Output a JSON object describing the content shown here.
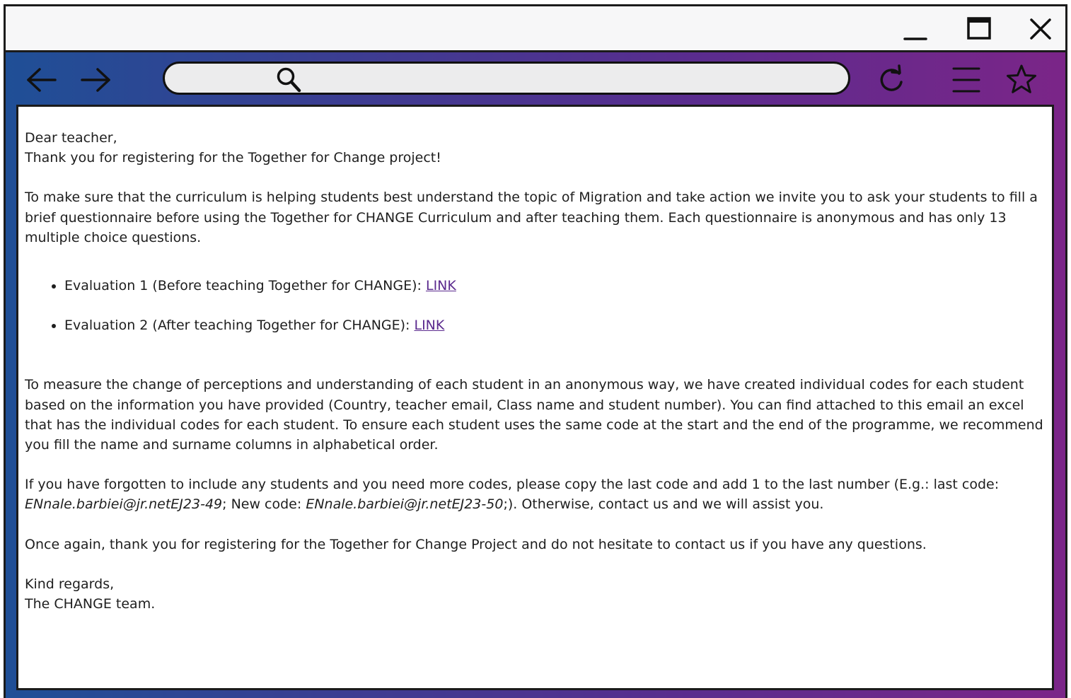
{
  "toolbar": {
    "back_icon": "arrow-left-icon",
    "forward_icon": "arrow-right-icon",
    "search_icon": "search-icon",
    "address_value": "",
    "reload_icon": "reload-icon",
    "menu_icon": "hamburger-menu-icon",
    "favorite_icon": "star-icon"
  },
  "window_controls": [
    "minimize-icon",
    "maximize-icon",
    "close-icon"
  ],
  "colors": {
    "gradient_start": "#1f4f96",
    "gradient_end": "#7b2588",
    "link": "#5b2a8e"
  },
  "email": {
    "greeting": "Dear teacher,",
    "thanks": "Thank you for registering for the Together for Change project!",
    "intro": "To make sure that the curriculum is helping students best understand the topic of Migration and take action we invite you to ask your students to fill a brief questionnaire before using the Together for CHANGE Curriculum and after teaching them. Each questionnaire is anonymous and has only 13 multiple choice questions.",
    "evaluations": [
      {
        "text": "Evaluation 1 (Before teaching Together for CHANGE): ",
        "link": "LINK"
      },
      {
        "text": "Evaluation 2 (After teaching Together for CHANGE): ",
        "link": "LINK"
      }
    ],
    "measure": "To measure the change of perceptions and understanding of each student in an anonymous way, we have created individual codes for each student based on the information you have provided (Country, teacher email, Class name and student number). You can find attached to this email an excel that has the individual codes for each student. To ensure each student uses the same code at the start and the end of the programme, we recommend you fill the name and surname columns in alphabetical order.",
    "forgotten_before": "If you have forgotten to include any students and you need more codes, please copy the last code and add 1 to the last number (E.g.: last code: ",
    "last_code": "ENnale.barbiei@jr.netEJ23-49",
    "new_code_label": "; New code: ",
    "new_code": "ENnale.barbiei@jr.netEJ23-50",
    "forgotten_after": ";). Otherwise, contact us and we will assist you.",
    "closing": "Once again, thank you for registering for the Together for Change Project and do not hesitate to contact us if you have any questions.",
    "regards": "Kind regards,",
    "signature": "The CHANGE team."
  }
}
